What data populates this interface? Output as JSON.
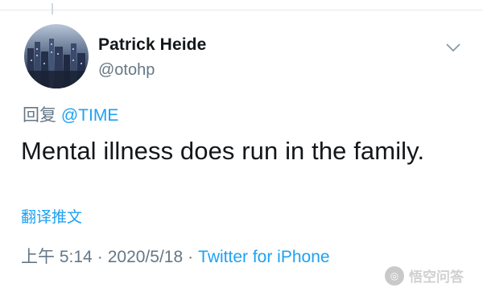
{
  "tweet": {
    "user": {
      "name": "Patrick Heide",
      "handle": "@otohp",
      "avatar": "avatar-cityscape"
    },
    "reply": {
      "prefix": "回复",
      "mention": "@TIME"
    },
    "text": "Mental illness does run in the family.",
    "translate_label": "翻译推文",
    "meta": {
      "time": "上午 5:14",
      "separator": "·",
      "date": "2020/5/18",
      "source": "Twitter for iPhone"
    }
  },
  "icons": {
    "caret": "chevron-down-icon"
  },
  "watermark": {
    "text": "悟空问答"
  },
  "colors": {
    "link": "#1da1f2",
    "secondary": "#657786",
    "primary": "#14171a"
  }
}
